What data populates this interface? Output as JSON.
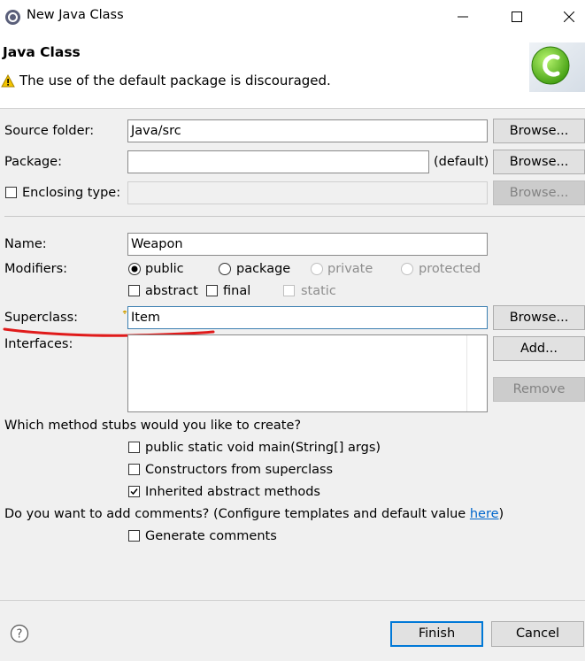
{
  "window": {
    "title": "New Java Class"
  },
  "header": {
    "title": "Java Class",
    "message": "The use of the default package is discouraged."
  },
  "source_folder": {
    "label": "Source folder:",
    "value": "Java/src",
    "browse": "Browse..."
  },
  "package": {
    "label": "Package:",
    "value": "",
    "default_text": "(default)",
    "browse": "Browse..."
  },
  "enclosing": {
    "label": "Enclosing type:",
    "value": "",
    "browse": "Browse..."
  },
  "name": {
    "label": "Name:",
    "value": "Weapon"
  },
  "modifiers": {
    "label": "Modifiers:",
    "public": "public",
    "package": "package",
    "private": "private",
    "protected": "protected",
    "abstract": "abstract",
    "final": "final",
    "static": "static",
    "selected": "public"
  },
  "superclass": {
    "label": "Superclass:",
    "value": "Item",
    "browse": "Browse..."
  },
  "interfaces": {
    "label": "Interfaces:",
    "add": "Add...",
    "remove": "Remove"
  },
  "stubs": {
    "question": "Which method stubs would you like to create?",
    "main": "public static void main(String[] args)",
    "constructors": "Constructors from superclass",
    "inherited": "Inherited abstract methods"
  },
  "comments": {
    "question": "Do you want to add comments? (Configure templates and default value ",
    "link": "here",
    "question_end": ")",
    "generate": "Generate comments"
  },
  "footer": {
    "finish": "Finish",
    "cancel": "Cancel"
  },
  "colors": {
    "link": "#0066cc",
    "annotation": "#e01b1b",
    "default_button_border": "#0078d7"
  }
}
